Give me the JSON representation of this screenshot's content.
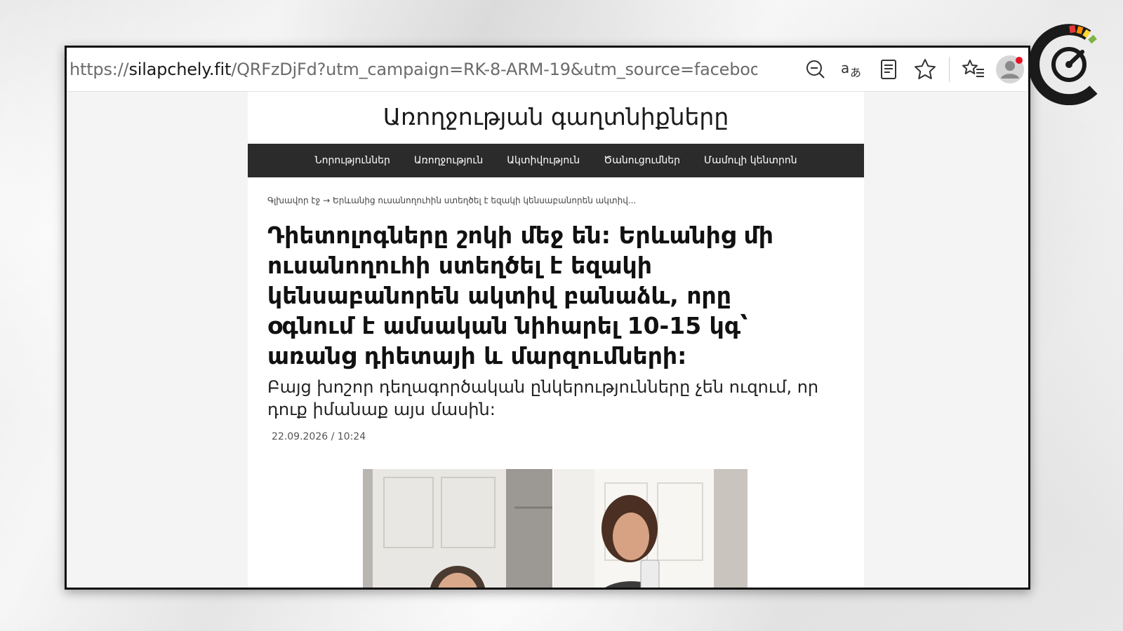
{
  "browser": {
    "url_prefix": "https://",
    "url_host": "silapchely.fit",
    "url_rest": "/QRFzDjFd?utm_campaign=RK-8-ARM-19&utm_source=facebook...",
    "icons": [
      "zoom-out-icon",
      "translate-icon",
      "reader-mode-icon",
      "favorite-star-icon",
      "favorites-list-icon",
      "profile-avatar-icon"
    ]
  },
  "site": {
    "title": "Առողջության գաղտնիքները",
    "nav": [
      "Նորություններ",
      "Առողջություն",
      "Ակտիվություն",
      "Ծանուցումներ",
      "Մամուլի կենտրոն"
    ]
  },
  "article": {
    "breadcrumb": "Գլխավոր էջ → Երևանից ուսանողուհին ստեղծել է եզակի կենսաբանորեն ակտիվ...",
    "headline": "Դիետոլոգները շոկի մեջ են: Երևանից մի ուսանողուհի ստեղծել է եզակի կենսաբանորեն ակտիվ բանաձև, որը օգնում է ամսական նիհարել 10-15 կգ՝ առանց դիետայի և մարզումների:",
    "subtitle": "Բայց խոշոր դեղագործական ընկերությունները չեն ուզում, որ դուք իմանաք այս մասին:",
    "date": "22.09.2026 / 10:24"
  },
  "colors": {
    "nav_bg": "#2b2b2b",
    "notification_dot": "#e81123"
  }
}
